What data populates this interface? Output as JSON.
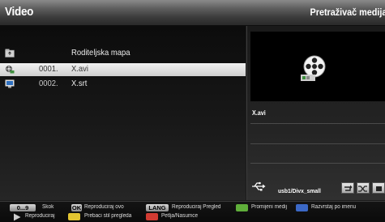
{
  "header": {
    "title": "Video",
    "right_title": "Pretraživač medija"
  },
  "files": [
    {
      "num": "",
      "name": "Roditeljska mapa",
      "icon": "folder-up-icon",
      "selected": false
    },
    {
      "num": "0001.",
      "name": "X.avi",
      "icon": "video-file-icon",
      "selected": true
    },
    {
      "num": "0002.",
      "name": "X.srt",
      "icon": "subtitle-file-icon",
      "selected": false
    }
  ],
  "preview": {
    "filename": "X.avi",
    "icon": "film-reel-icon"
  },
  "device": {
    "path": "usb1/Divx_small",
    "icon": "usb-icon"
  },
  "keys": {
    "k09": "0...9",
    "k09_label": "Skok",
    "ok": "OK",
    "ok_label": "Reproduciraj ovo",
    "lang": "LANG",
    "lang_label": "Reproduciraj Pregled",
    "green_label": "Promijeni medij",
    "blue_label": "Razvrstaj po imenu",
    "play_label": "Reproduciraj",
    "yellow_label": "Prebaci stil pregleda",
    "red_label": "Petlja/Nasumce"
  },
  "colors": {
    "selection": "#e0e0e0",
    "background": "#1b1b1b",
    "green": "#5fae3a",
    "blue": "#3b68c6",
    "yellow": "#e3c531",
    "red": "#d13b32"
  }
}
